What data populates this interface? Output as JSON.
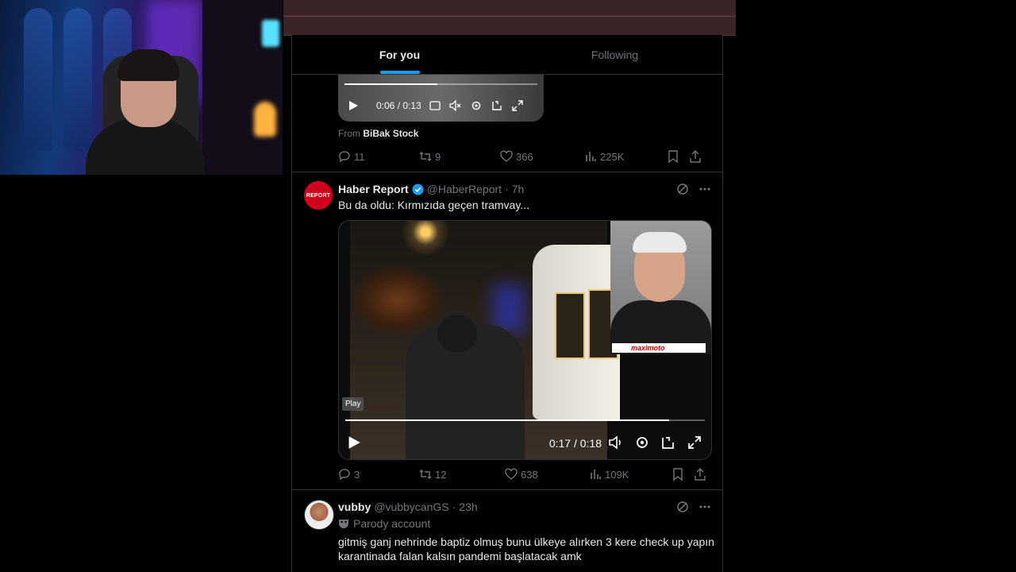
{
  "tabs": {
    "for_you": "For you",
    "following": "Following"
  },
  "tweet1": {
    "video_time": "0:06 / 0:13",
    "progress_fraction": 0.48,
    "from_prefix": "From",
    "from_source": "BiBak Stock",
    "replies": "11",
    "reposts": "9",
    "likes": "366",
    "views": "225K"
  },
  "tweet2": {
    "avatar_text": "REPORT",
    "name": "Haber Report",
    "handle": "@HaberReport",
    "dot": "·",
    "time": "7h",
    "text": "Bu da oldu: Kırmızıda geçen tramvay...",
    "play_tooltip": "Play",
    "video_time": "0:17 / 0:18",
    "progress_fraction": 0.9,
    "inset_logo": "maximoto",
    "replies": "3",
    "reposts": "12",
    "likes": "638",
    "views": "109K"
  },
  "tweet3": {
    "name": "vubby",
    "handle": "@vubbycanGS",
    "dot": "·",
    "time": "23h",
    "label": "Parody account",
    "text_line1": "gitmiş ganj nehrinde baptiz olmuş bunu ülkeye alırken 3 kere check up yapın",
    "text_line2": "karantinada falan kalsın pandemi başlatacak amk"
  },
  "colors": {
    "accent": "#1d9bf0",
    "background": "#000000",
    "text_primary": "#e7e9ea",
    "text_secondary": "#71767b",
    "border": "#2f3336",
    "topbar": "#3a2426"
  }
}
